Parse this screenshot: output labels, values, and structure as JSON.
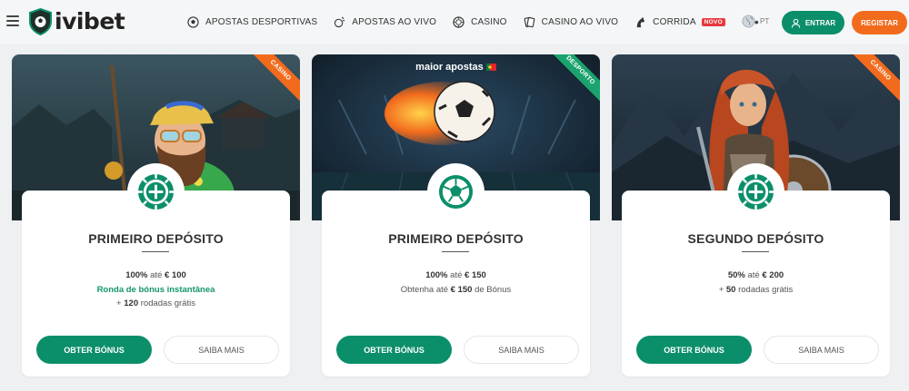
{
  "brand": {
    "name": "ivibet"
  },
  "nav": [
    {
      "label": "APOSTAS DESPORTIVAS",
      "icon": "soccer-ball-icon"
    },
    {
      "label": "APOSTAS AO VIVO",
      "icon": "live-sports-icon"
    },
    {
      "label": "CASINO",
      "icon": "casino-chip-icon"
    },
    {
      "label": "CASINO AO VIVO",
      "icon": "live-casino-icon"
    },
    {
      "label": "CORRIDA",
      "icon": "horse-racing-icon",
      "badge": "NOVO"
    }
  ],
  "more": "•••",
  "language": {
    "code": "PT",
    "icon": "globe-icon"
  },
  "auth": {
    "login": "ENTRAR",
    "register": "REGISTAR"
  },
  "colors": {
    "green": "#0b8f6a",
    "orange": "#f26b1d",
    "novo": "#e8383d",
    "background": "#eef0f2"
  },
  "promos": [
    {
      "ribbon": "CASINO",
      "hero_caption": "",
      "badge_icon": "casino-chip-icon",
      "title": "PRIMEIRO DEPÓSITO",
      "line1_value": "100%",
      "line1_mid": "até",
      "line1_amount": "€ 100",
      "line2": "Ronda de bónus instantânea",
      "line3_prefix": "+",
      "line3_value": "120",
      "line3_suffix": "rodadas grátis",
      "cta": "OBTER BÓNUS",
      "more": "SAIBA MAIS"
    },
    {
      "ribbon": "DESPORTO",
      "hero_caption": "maior apostas",
      "badge_icon": "soccer-ball-icon",
      "title": "PRIMEIRO DEPÓSITO",
      "line1_value": "100%",
      "line1_mid": "até",
      "line1_amount": "€ 150",
      "line2_prefix": "Obtenha até",
      "line2_amount": "€ 150",
      "line2_suffix": "de Bónus",
      "cta": "OBTER BÓNUS",
      "more": "SAIBA MAIS"
    },
    {
      "ribbon": "CASINO",
      "hero_caption": "",
      "badge_icon": "casino-chip-icon",
      "title": "SEGUNDO DEPÓSITO",
      "line1_value": "50%",
      "line1_mid": "até",
      "line1_amount": "€ 200",
      "line2_prefix": "+",
      "line2_value": "50",
      "line2_suffix": "rodadas grátis",
      "cta": "OBTER BÓNUS",
      "more": "SAIBA MAIS"
    }
  ]
}
